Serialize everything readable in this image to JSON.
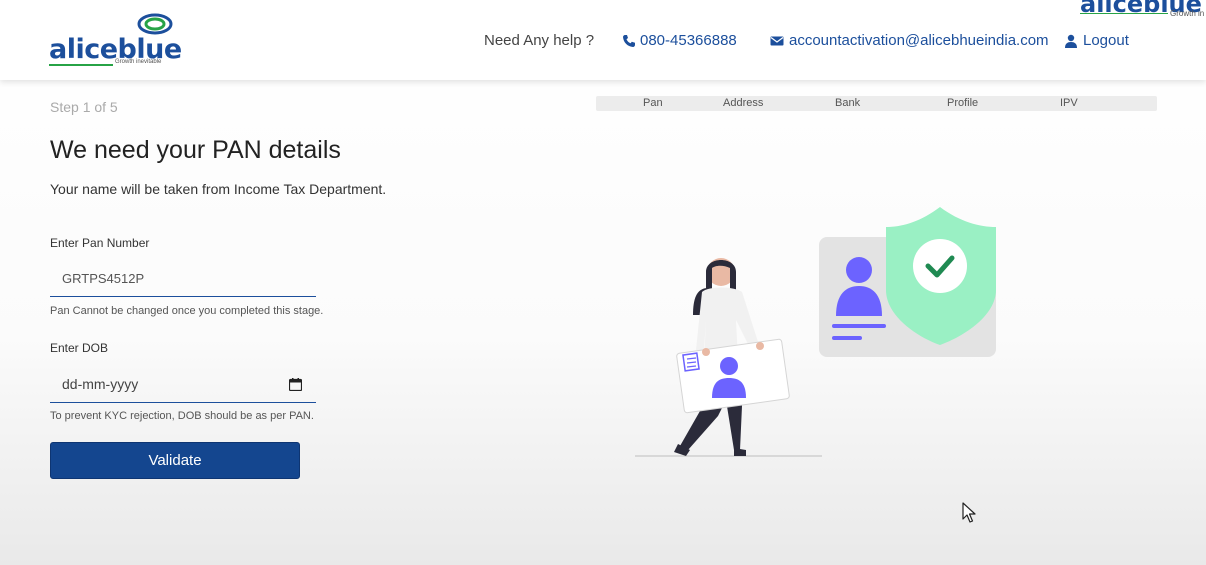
{
  "header": {
    "logo_text": "aliceblue",
    "logo_tagline": "Growth inevitable",
    "corner_logo_text": "aliceblue",
    "corner_logo_tagline": "Growth in",
    "help_text": "Need Any help ?",
    "phone": "080-45366888",
    "email": "accountactivation@alicebhueindia.com",
    "logout_label": "Logout"
  },
  "progress": {
    "step_label": "Step 1 of 5",
    "steps": [
      "Pan",
      "Address",
      "Bank",
      "Profile",
      "IPV"
    ]
  },
  "form": {
    "title": "We need your PAN details",
    "subtitle": "Your name will be taken from Income Tax Department.",
    "pan_label": "Enter Pan Number",
    "pan_value": "GRTPS4512P",
    "pan_hint": "Pan Cannot be changed once you completed this stage.",
    "dob_label": "Enter DOB",
    "dob_placeholder": "dd-mm-yyyy",
    "dob_hint": "To prevent KYC rejection, DOB should be as per PAN.",
    "validate_label": "Validate"
  },
  "colors": {
    "brand_blue": "#1c4f9c",
    "button_blue": "#14468f",
    "brand_green": "#27a346",
    "shield_green": "#9af0c4",
    "avatar_purple": "#6c63ff"
  }
}
